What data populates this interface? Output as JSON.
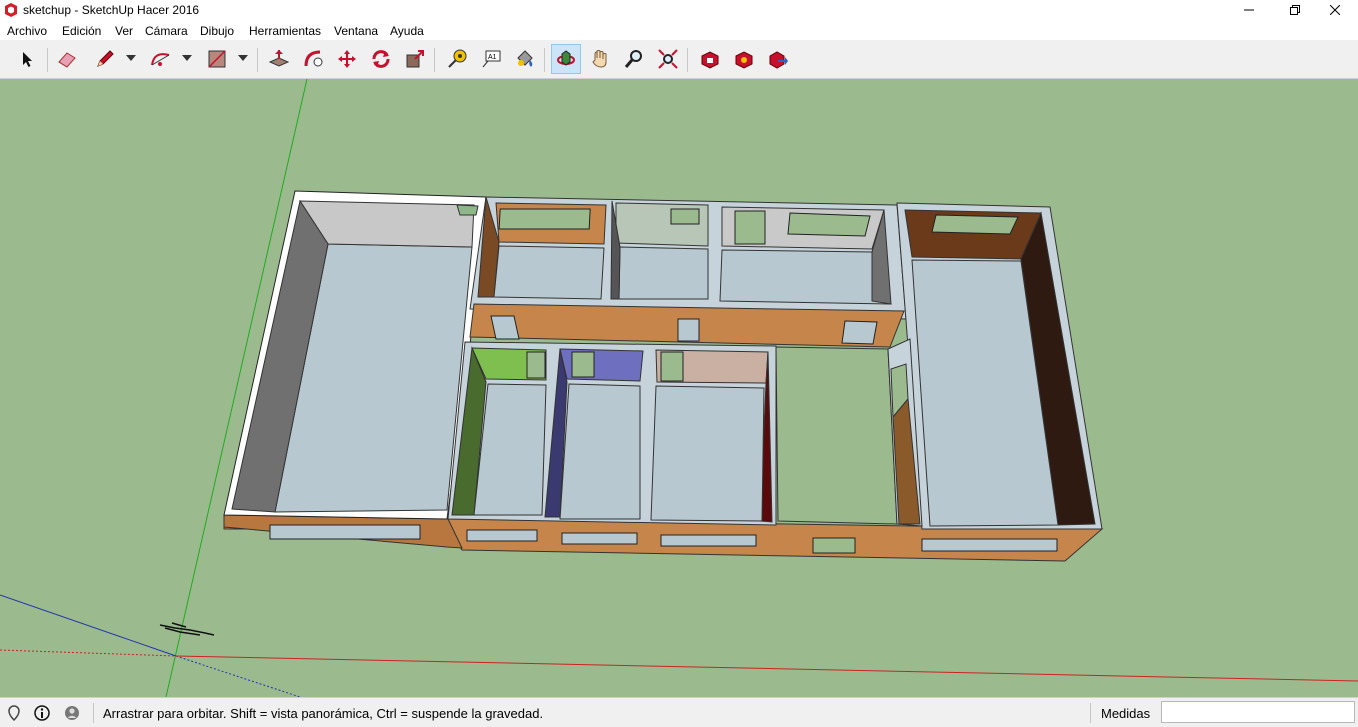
{
  "window": {
    "title": "sketchup - SketchUp Hacer 2016"
  },
  "menu": {
    "items": [
      "Archivo",
      "Edición",
      "Ver",
      "Cámara",
      "Dibujo",
      "Herramientas",
      "Ventana",
      "Ayuda"
    ]
  },
  "toolbar": {
    "tools": [
      {
        "name": "select-tool",
        "icon": "arrow-cursor-icon"
      },
      {
        "name": "eraser-tool",
        "icon": "eraser-icon"
      },
      {
        "name": "line-tool",
        "icon": "pencil-icon"
      },
      {
        "name": "arc-tool",
        "icon": "arc-icon"
      },
      {
        "name": "rectangle-tool",
        "icon": "rectangle-icon"
      },
      {
        "name": "push-pull-tool",
        "icon": "push-pull-icon"
      },
      {
        "name": "follow-me-tool",
        "icon": "follow-me-icon"
      },
      {
        "name": "move-tool",
        "icon": "move-arrows-icon"
      },
      {
        "name": "rotate-tool",
        "icon": "rotate-icon"
      },
      {
        "name": "scale-tool",
        "icon": "scale-icon"
      },
      {
        "name": "tape-measure-tool",
        "icon": "tape-measure-icon"
      },
      {
        "name": "text-tool",
        "icon": "text-label-icon"
      },
      {
        "name": "paint-bucket-tool",
        "icon": "paint-bucket-icon"
      },
      {
        "name": "orbit-tool",
        "icon": "orbit-icon"
      },
      {
        "name": "pan-tool",
        "icon": "hand-icon"
      },
      {
        "name": "zoom-tool",
        "icon": "magnifier-icon"
      },
      {
        "name": "zoom-extents-tool",
        "icon": "zoom-extents-icon"
      },
      {
        "name": "warehouse-tool",
        "icon": "3d-warehouse-icon"
      },
      {
        "name": "extension-warehouse-tool",
        "icon": "extension-warehouse-icon"
      },
      {
        "name": "share-model-tool",
        "icon": "share-model-icon"
      }
    ],
    "active_tool": "orbit-tool"
  },
  "status": {
    "message": "Arrastrar para orbitar. Shift = vista panorámica, Ctrl = suspende la gravedad.",
    "measure_label": "Medidas",
    "measure_value": ""
  },
  "colors": {
    "ground": "#9bbb8f",
    "floor": "#b7c8d0",
    "wall_top": "#c6d3da",
    "wood": "#c6854b",
    "dark_brown": "#2e1a10",
    "green_wall": "#4a6b2e",
    "purple_wall": "#6f6fc0",
    "axis_green": "#22aa22",
    "axis_red": "#cc2222",
    "axis_blue": "#2233aa"
  }
}
